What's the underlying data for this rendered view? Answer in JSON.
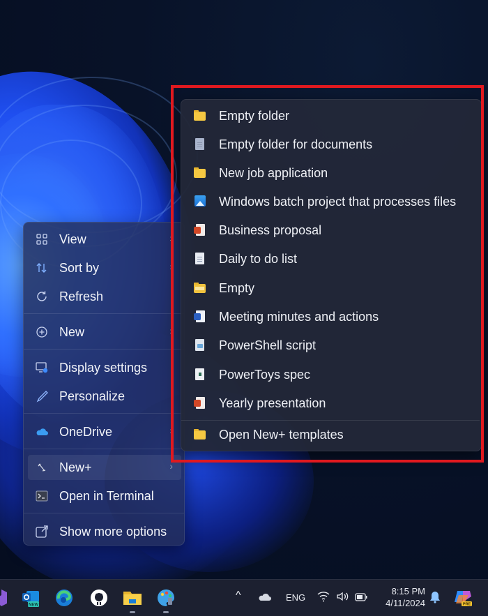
{
  "context_menu": {
    "items": [
      {
        "label": "View",
        "icon": "grid-view-icon",
        "has_submenu": true
      },
      {
        "label": "Sort by",
        "icon": "sort-arrows-icon",
        "has_submenu": true
      },
      {
        "label": "Refresh",
        "icon": "refresh-icon",
        "has_submenu": false
      },
      {
        "label": "New",
        "icon": "plus-circle-icon",
        "has_submenu": true
      },
      {
        "label": "Display settings",
        "icon": "display-settings-icon",
        "has_submenu": false
      },
      {
        "label": "Personalize",
        "icon": "brush-icon",
        "has_submenu": false
      },
      {
        "label": "OneDrive",
        "icon": "onedrive-cloud-icon",
        "has_submenu": true
      },
      {
        "label": "New+",
        "icon": "new-plus-icon",
        "has_submenu": true,
        "highlighted": true
      },
      {
        "label": "Open in Terminal",
        "icon": "terminal-icon",
        "has_submenu": false
      },
      {
        "label": "Show more options",
        "icon": "show-more-icon",
        "has_submenu": false
      }
    ],
    "chevron": "›"
  },
  "new_plus_submenu": {
    "items": [
      {
        "label": "Empty folder",
        "icon": "folder-icon"
      },
      {
        "label": "Empty folder for documents",
        "icon": "document-icon"
      },
      {
        "label": "New job application",
        "icon": "folder-icon"
      },
      {
        "label": "Windows batch project that processes files",
        "icon": "image-icon"
      },
      {
        "label": "Business proposal",
        "icon": "powerpoint-icon"
      },
      {
        "label": "Daily to do list",
        "icon": "text-document-icon"
      },
      {
        "label": "Empty",
        "icon": "open-folder-icon"
      },
      {
        "label": "Meeting minutes and actions",
        "icon": "word-icon"
      },
      {
        "label": "PowerShell script",
        "icon": "powershell-script-icon"
      },
      {
        "label": "PowerToys spec",
        "icon": "markdown-icon"
      },
      {
        "label": "Yearly presentation",
        "icon": "powerpoint-icon"
      }
    ],
    "footer": {
      "label": "Open New+ templates",
      "icon": "folder-icon"
    }
  },
  "annotation": {
    "color": "#e0191f"
  },
  "taskbar": {
    "apps": [
      {
        "name": "visual-studio",
        "running": false
      },
      {
        "name": "outlook-new",
        "badge": "NEW",
        "running": false
      },
      {
        "name": "edge",
        "running": false
      },
      {
        "name": "github-desktop",
        "running": false
      },
      {
        "name": "file-explorer",
        "running": true
      },
      {
        "name": "paint",
        "running": true
      }
    ],
    "tray": {
      "overflow_glyph": "^",
      "language": "ENG",
      "time": "8:15 PM",
      "date": "4/11/2024",
      "copilot_badge": "PRE"
    }
  }
}
